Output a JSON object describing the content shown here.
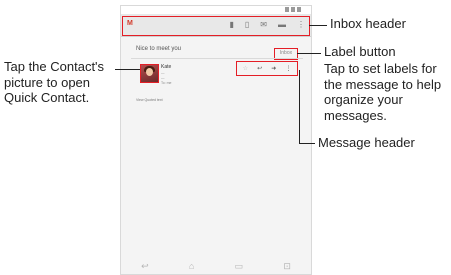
{
  "app": {
    "logo": "M",
    "actions": [
      "▮",
      "▯",
      "✉",
      "▬",
      "⋮"
    ]
  },
  "message": {
    "subject": "Nice to meet you",
    "label_button": "Inbox",
    "sender": {
      "name": "Kate",
      "line1": "—",
      "line2": "—",
      "line3": "To: me"
    },
    "actions": [
      "☆",
      "↩",
      "➜",
      "⋮"
    ],
    "body": "View Quoted text"
  },
  "nav": [
    "↩",
    "⌂",
    "▭",
    "⊡"
  ],
  "callouts": {
    "contact": "Tap the Contact's picture to open Quick Contact.",
    "inbox_header": "Inbox header",
    "label_button": "Label button",
    "label_desc": "Tap to set labels for the message to help organize your messages.",
    "message_header": "Message header"
  },
  "colors": {
    "highlight": "#e41e26",
    "logo": "#d23a2a"
  }
}
